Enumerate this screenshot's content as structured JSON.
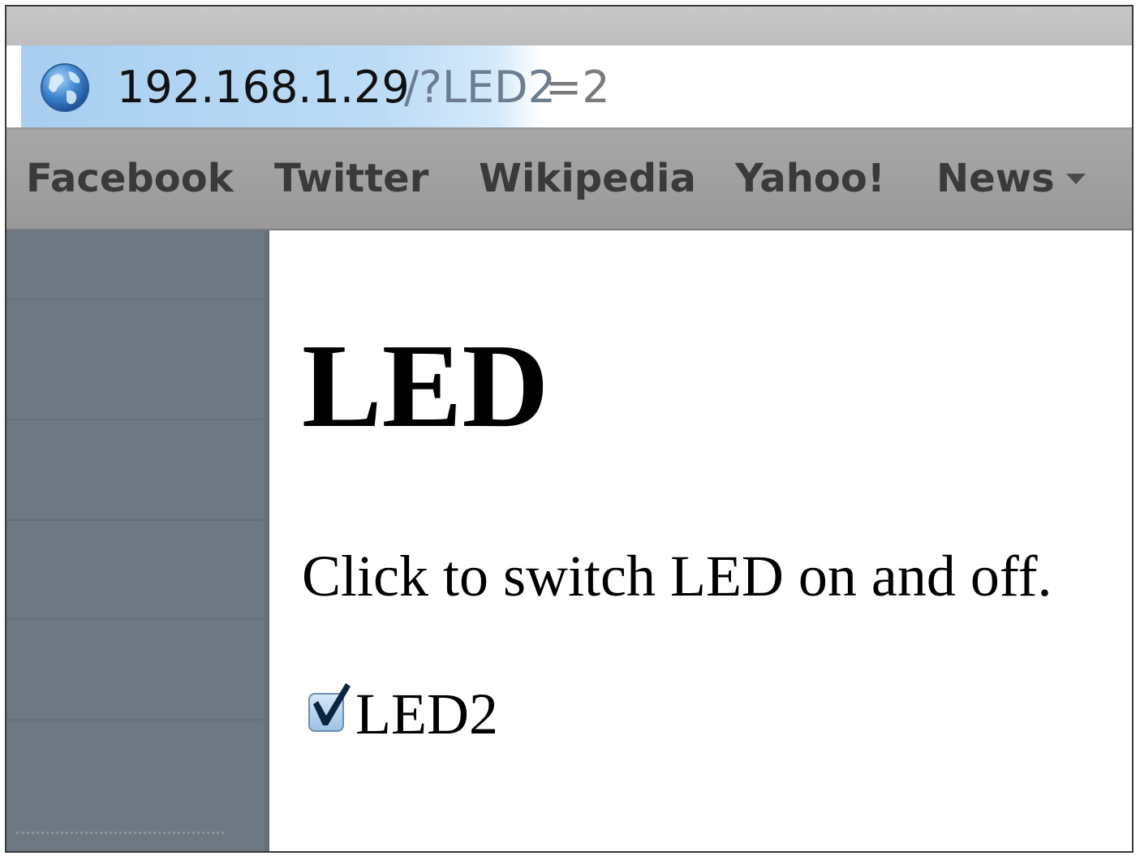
{
  "browser": {
    "address_bar": {
      "host": "192.168.1.29",
      "path": "/?LED2",
      "query_value": "=2",
      "icon": "globe-icon"
    },
    "bookmarks": [
      {
        "label": "Facebook"
      },
      {
        "label": "Twitter"
      },
      {
        "label": "Wikipedia"
      },
      {
        "label": "Yahoo!"
      },
      {
        "label": "News",
        "icon": "chevron-down-icon"
      }
    ]
  },
  "page": {
    "heading": "LED",
    "instruction": "Click to switch LED on and off.",
    "checkbox": {
      "label": "LED2",
      "checked": true
    }
  },
  "colors": {
    "address_highlight": "#bcdcf6",
    "bookmarks_bar": "#a2a2a2",
    "sidebar": "#6e7883",
    "checkbox_fill": "#9cc3e6"
  }
}
